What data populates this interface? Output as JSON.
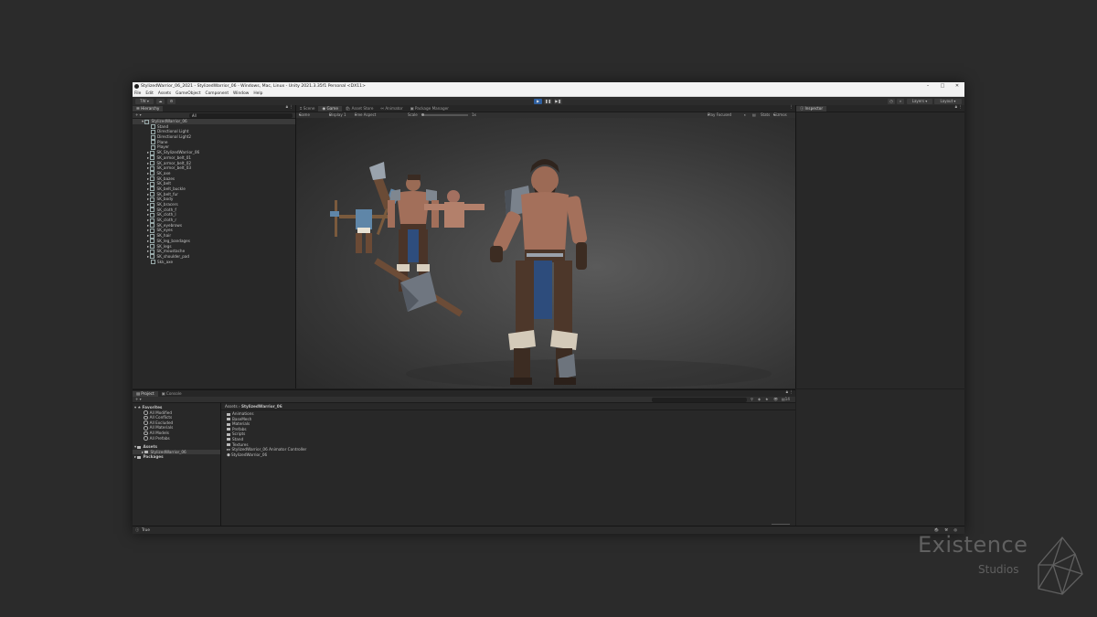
{
  "window": {
    "title": "StylizedWarrior_06_2021 - StylizedWarrior_06 - Windows, Mac, Linux - Unity 2021.3.35f1 Personal <DX11>",
    "controls": {
      "minimize": "–",
      "maximize": "□",
      "close": "✕"
    }
  },
  "menu": [
    "File",
    "Edit",
    "Assets",
    "GameObject",
    "Component",
    "Window",
    "Help"
  ],
  "toolbar": {
    "account": "TW",
    "play_buttons": [
      "▶",
      "❚❚",
      "▶❚"
    ],
    "layers": "Layers",
    "layout": "Layout"
  },
  "hierarchy": {
    "tab": "Hierarchy",
    "search_placeholder": "All",
    "root": "StylizedWarrior_06",
    "items": [
      "Stand",
      "Directional Light",
      "Directional Light2",
      "Plane",
      "Player",
      "SK_StylizedWarrior_06",
      "SK_armor_belt_01",
      "SK_armor_belt_02",
      "SK_armor_belt_03",
      "SK_axe",
      "SK_bazes",
      "SK_belt",
      "SK_belt_buckle",
      "SK_belt_fur",
      "SK_body",
      "SK_bracers",
      "SK_cloth_f",
      "SK_cloth_l",
      "SK_cloth_r",
      "SK_eyebrows",
      "SK_eyes",
      "SK_hair",
      "SK_leg_bandages",
      "SK_legs",
      "SK_moustache",
      "SK_shoulder_pad",
      "Skk_axe"
    ]
  },
  "center_tabs": [
    "Scene",
    "Game",
    "Asset Store",
    "Animator",
    "Package Manager"
  ],
  "game_bar": {
    "view": "Game",
    "display": "Display 1",
    "aspect": "Free Aspect",
    "scale_label": "Scale",
    "scale_value": "1x",
    "play_focused": "Play Focused",
    "stats": "Stats",
    "gizmos": "Gizmos"
  },
  "inspector": {
    "tab": "Inspector"
  },
  "bottom_tabs": [
    "Project",
    "Console"
  ],
  "project": {
    "favorites_label": "Favorites",
    "favorites": [
      "All Modified",
      "All Conflicts",
      "All Excluded",
      "All Materials",
      "All Models",
      "All Prefabs"
    ],
    "assets_label": "Assets",
    "assets_child": "StylizedWarrior_06",
    "packages_label": "Packages",
    "breadcrumb": [
      "Assets",
      "StylizedWarrior_06"
    ],
    "folders": [
      "Animations",
      "BaseMesh",
      "Materials",
      "Prefabs",
      "Scripts",
      "Stand",
      "Textures"
    ],
    "files": [
      "StylizedWarrior_06 Animator Controller",
      "StylizedWarrior_06"
    ],
    "count": "14"
  },
  "status": {
    "text": "True"
  },
  "watermark": {
    "line1": "Existence",
    "line2": "Studios"
  },
  "colors": {
    "play_active": "#2f5f9f",
    "accent_blue": "#3a6dbb"
  }
}
